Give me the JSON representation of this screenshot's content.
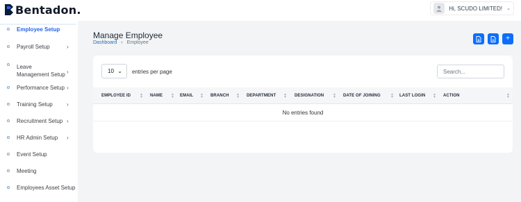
{
  "brand": {
    "name": "Bentadon."
  },
  "user": {
    "greeting": "Hi, SCUDO LIMITED!"
  },
  "sidebar": {
    "items": [
      {
        "label": "Employee Setup",
        "active": true,
        "chevron": false
      },
      {
        "label": "Payroll Setup",
        "chevron": true
      },
      {
        "label": "Leave Management Setup",
        "chevron": true
      },
      {
        "label": "Performance Setup",
        "chevron": true
      },
      {
        "label": "Training Setup",
        "chevron": true
      },
      {
        "label": "Recruitment Setup",
        "chevron": true
      },
      {
        "label": "HR Admin Setup",
        "chevron": true
      },
      {
        "label": "Event Setup",
        "chevron": false
      },
      {
        "label": "Meeting",
        "chevron": false
      },
      {
        "label": "Employees Asset Setup",
        "chevron": false
      }
    ]
  },
  "page": {
    "title": "Manage Employee",
    "breadcrumb": {
      "root": "Dashboard",
      "current": "Employee",
      "separator": "›"
    }
  },
  "toolbar": {
    "import_icon": "import-icon",
    "export_icon": "export-icon",
    "add_label": "+"
  },
  "table": {
    "page_size": "10",
    "entries_label": "entries per page",
    "search_placeholder": "Search...",
    "columns": [
      "EMPLOYEE ID",
      "NAME",
      "EMAIL",
      "BRANCH",
      "DEPARTMENT",
      "DESIGNATION",
      "DATE OF JOINING",
      "LAST LOGIN",
      "ACTION"
    ],
    "empty_message": "No entries found"
  },
  "colors": {
    "accent": "#0d6efd",
    "link": "#2b6cb0",
    "active_nav": "#2563eb"
  }
}
